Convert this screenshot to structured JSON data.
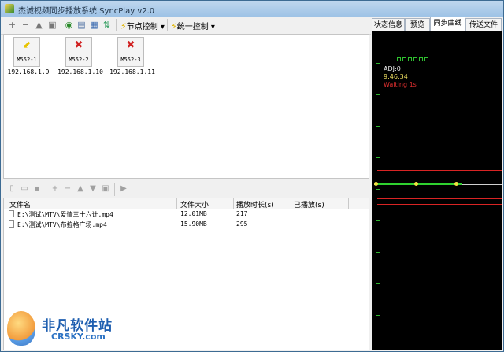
{
  "window": {
    "title": "杰诚视频同步播放系统 SyncPlay v2.0"
  },
  "toolbar": {
    "node_control_label": "节点控制",
    "unified_control_label": "统一控制"
  },
  "nodes": [
    {
      "name": "M552-1",
      "ip": "192.168.1.9",
      "status": "playing"
    },
    {
      "name": "M552-2",
      "ip": "192.168.1.10",
      "status": "error"
    },
    {
      "name": "M552-3",
      "ip": "192.168.1.11",
      "status": "error"
    }
  ],
  "file_table": {
    "columns": [
      "文件名",
      "文件大小",
      "播放时长(s)",
      "已播放(s)"
    ],
    "rows": [
      {
        "name": "E:\\测试\\MTV\\爱情三十六计.mp4",
        "size": "12.01MB",
        "duration": "217",
        "played": ""
      },
      {
        "name": "E:\\测试\\MTV\\布拉格广场.mp4",
        "size": "15.90MB",
        "duration": "295",
        "played": ""
      }
    ]
  },
  "right_tabs": [
    "状态信息",
    "预览",
    "同步曲线",
    "传送文件"
  ],
  "active_tab": "同步曲线",
  "sync_view": {
    "adj": "ADJ:0",
    "time": "9:46:34",
    "status": "Waiting 1s",
    "colors": {
      "adj": "#f0f0f0",
      "time": "#f0e060",
      "status": "#e03030"
    }
  },
  "watermark": {
    "title": "非凡软件站",
    "site": "CRSKY.com"
  }
}
